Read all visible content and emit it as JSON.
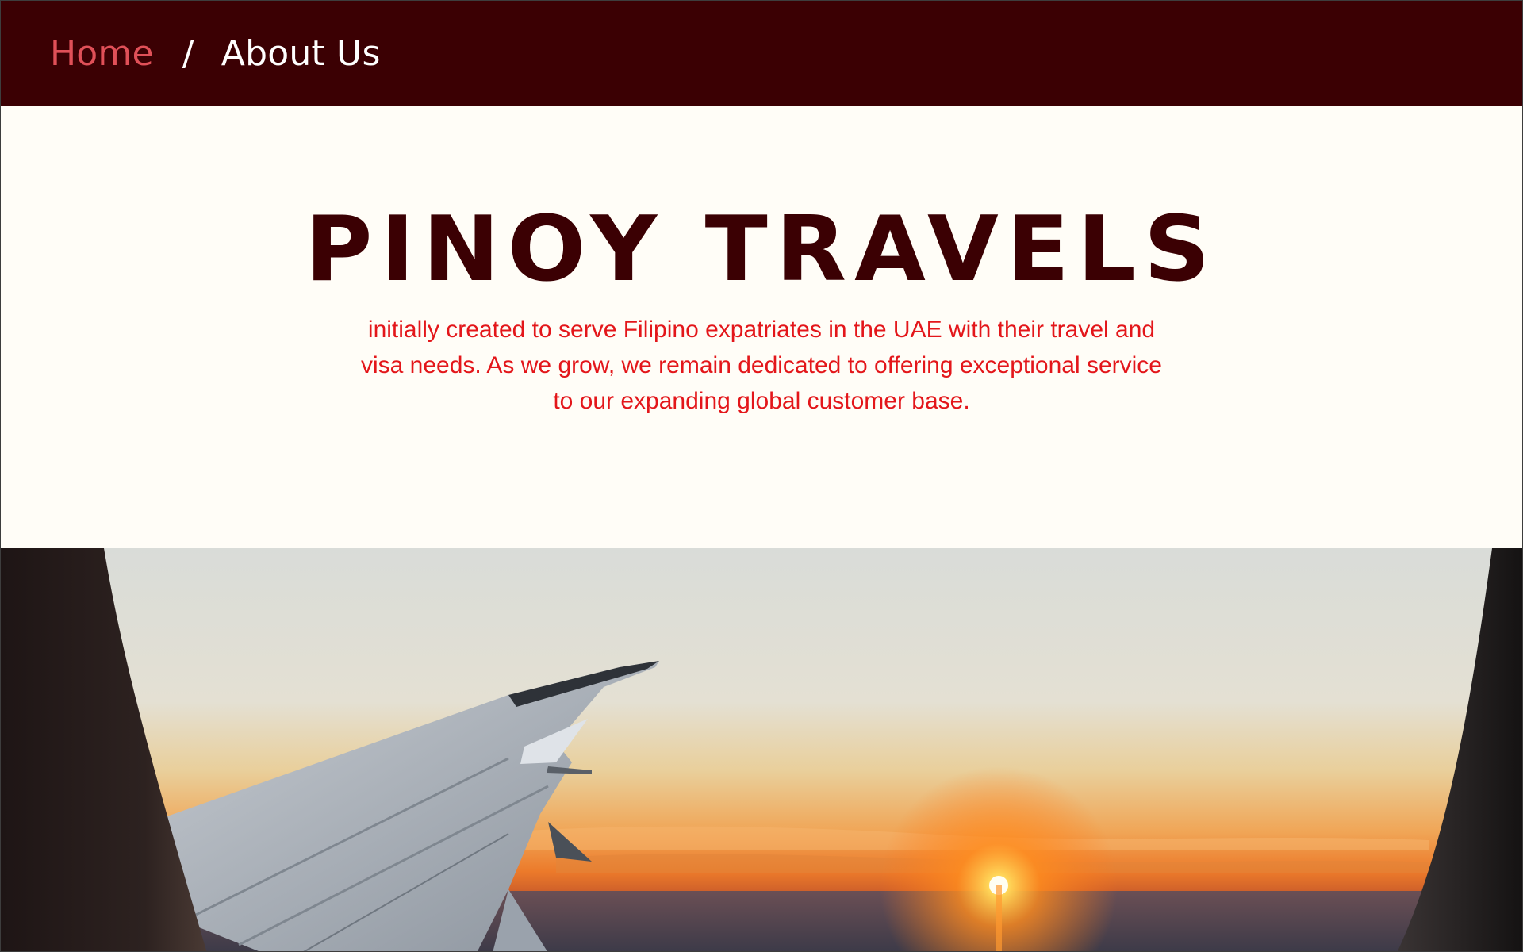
{
  "breadcrumb": {
    "home_label": "Home",
    "separator": "/",
    "current_label": "About Us"
  },
  "hero": {
    "title": "PINOY TRAVELS",
    "tagline": "initially created to serve Filipino expatriates in the UAE with their travel and visa needs. As we grow, we remain dedicated to offering exceptional service to our expanding global customer base."
  },
  "colors": {
    "bar": "#3b0003",
    "home_link": "#e05058",
    "title": "#3b0003",
    "tagline": "#e3161a",
    "background": "#fffdf7"
  },
  "banner_icon": "airplane-wing-sunset-photo"
}
